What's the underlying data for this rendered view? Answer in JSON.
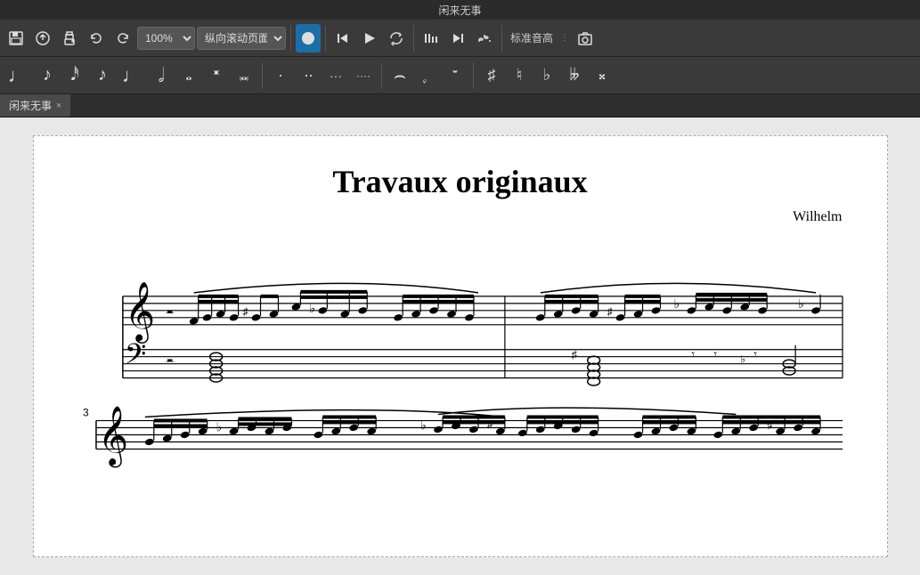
{
  "titleBar": {
    "text": "闲来无事"
  },
  "toolbar1": {
    "zoom": "100%",
    "viewMode": "纵向滚动页面",
    "buttons": [
      {
        "name": "save",
        "icon": "💾",
        "label": "保存"
      },
      {
        "name": "upload",
        "icon": "☁",
        "label": "上传"
      },
      {
        "name": "print",
        "icon": "🖨",
        "label": "打印"
      },
      {
        "name": "undo",
        "icon": "↩",
        "label": "撤销"
      },
      {
        "name": "redo",
        "icon": "↪",
        "label": "重做"
      },
      {
        "name": "cursor",
        "icon": "✥",
        "label": "光标"
      },
      {
        "name": "rewind",
        "icon": "⏮",
        "label": "回到开头"
      },
      {
        "name": "play",
        "icon": "▶",
        "label": "播放"
      },
      {
        "name": "loop",
        "icon": "↺",
        "label": "循环"
      },
      {
        "name": "voices",
        "icon": "⠿",
        "label": "声部"
      },
      {
        "name": "next",
        "icon": "⏭",
        "label": "下一个"
      },
      {
        "name": "mixer",
        "icon": "🎚",
        "label": "混音器"
      },
      {
        "name": "standardPitch",
        "label": "标准音高"
      },
      {
        "name": "camera",
        "icon": "📷",
        "label": "截图"
      }
    ]
  },
  "toolbar2": {
    "notes": [
      {
        "name": "note64",
        "symbol": "𝅘𝅥𝅲",
        "label": "六十四分音符"
      },
      {
        "name": "note32",
        "symbol": "𝅘𝅥𝅱",
        "label": "三十二分音符"
      },
      {
        "name": "note16",
        "symbol": "𝅘𝅥𝅰",
        "label": "十六分音符"
      },
      {
        "name": "note8",
        "symbol": "𝅘𝅥𝅯",
        "label": "八分音符"
      },
      {
        "name": "note4",
        "symbol": "𝅘𝅥",
        "label": "四分音符"
      },
      {
        "name": "note2",
        "symbol": "𝅗𝅥",
        "label": "二分音符"
      },
      {
        "name": "noteWhole",
        "symbol": "𝅝",
        "label": "全音符"
      },
      {
        "name": "noteBreve",
        "symbol": "𝅜",
        "label": "倍全音符"
      },
      {
        "name": "noteSpecial",
        "symbol": "𝄺",
        "label": "特殊音符"
      },
      {
        "name": "dot1",
        "symbol": "·",
        "label": "附点"
      },
      {
        "name": "dot2",
        "symbol": "··",
        "label": "双附点"
      },
      {
        "name": "dot3",
        "symbol": "···",
        "label": "三附点"
      },
      {
        "name": "dot4",
        "symbol": "····",
        "label": "四附点"
      },
      {
        "name": "tie",
        "symbol": "⌢",
        "label": "连音线"
      },
      {
        "name": "triplet",
        "symbol": "𝆀",
        "label": "三连音"
      },
      {
        "name": "rest",
        "symbol": "𝄻",
        "label": "休止符"
      },
      {
        "name": "sharp",
        "symbol": "♯",
        "label": "升号"
      },
      {
        "name": "natural",
        "symbol": "♮",
        "label": "还原号"
      },
      {
        "name": "flat",
        "symbol": "♭",
        "label": "降号"
      },
      {
        "name": "doubleFlat",
        "symbol": "𝄫",
        "label": "重降号"
      },
      {
        "name": "cautionary",
        "symbol": "𝄪",
        "label": "提醒变音"
      }
    ]
  },
  "tab": {
    "label": "闲来无事",
    "closeLabel": "×"
  },
  "score": {
    "title": "Travaux originaux",
    "composer": "Wilhelm"
  }
}
